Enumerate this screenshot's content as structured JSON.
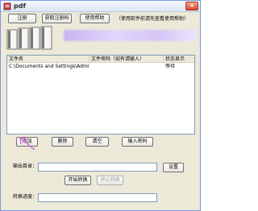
{
  "window": {
    "title": "pdf",
    "close_symbol": "×",
    "app_icon": "pdf-app-icon"
  },
  "toolbar": {
    "register_label": "注册",
    "get_code_label": "获取注册码",
    "help_label": "使用帮助",
    "hint_text": "（使用软件前请先查看使用帮助）"
  },
  "banner": {
    "icon": "documents-icon"
  },
  "file_list": {
    "columns": [
      "文件名",
      "文件密码（如有请输入）",
      "状态显示"
    ],
    "rows": [
      {
        "filename": "C:\\Documents and Settings\\Administr...",
        "password": "",
        "status": "等待"
      }
    ]
  },
  "actions": {
    "add_label": "添加",
    "delete_label": "删除",
    "clear_label": "清空",
    "enter_password_label": "输入密码"
  },
  "output": {
    "label": "输出目录：",
    "value": "",
    "settings_label": "设置"
  },
  "convert": {
    "start_label": "开始转换",
    "stop_label": "停止转换",
    "progress_label": "转换进度："
  },
  "colors": {
    "window_bg": "#ece9d8",
    "pointer_arrow": "#d070d8"
  }
}
